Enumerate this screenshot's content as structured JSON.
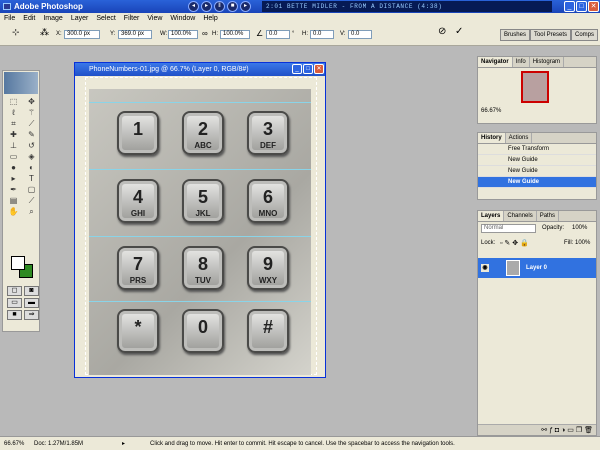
{
  "titlebar": {
    "title": "Adobe Photoshop",
    "track": "2:01   BETTE MIDLER - FROM A DISTANCE (4:38)"
  },
  "menu": [
    "File",
    "Edit",
    "Image",
    "Layer",
    "Select",
    "Filter",
    "View",
    "Window",
    "Help"
  ],
  "options": {
    "x_label": "X:",
    "x_value": "300.0 px",
    "y_label": "Y:",
    "y_value": "369.0 px",
    "w_label": "W:",
    "w_value": "100.0%",
    "h_label": "H:",
    "h_value": "100.0%",
    "angle": "0.0",
    "angle_unit": "°",
    "h_skew_label": "H:",
    "h_skew": "0.0",
    "v_skew_label": "V:",
    "v_skew": "0.0",
    "tabs": [
      "Brushes",
      "Tool Presets",
      "Comps"
    ]
  },
  "document": {
    "title": "PhoneNumbers-01.jpg @ 66.7% (Layer 0, RGB/8#)",
    "keys": [
      {
        "d": "1",
        "l": ""
      },
      {
        "d": "2",
        "l": "ABC"
      },
      {
        "d": "3",
        "l": "DEF"
      },
      {
        "d": "4",
        "l": "GHI"
      },
      {
        "d": "5",
        "l": "JKL"
      },
      {
        "d": "6",
        "l": "MNO"
      },
      {
        "d": "7",
        "l": "PRS"
      },
      {
        "d": "8",
        "l": "TUV"
      },
      {
        "d": "9",
        "l": "WXY"
      },
      {
        "d": "*",
        "l": ""
      },
      {
        "d": "0",
        "l": ""
      },
      {
        "d": "#",
        "l": ""
      }
    ]
  },
  "navigator": {
    "tabs": [
      "Navigator",
      "Info",
      "Histogram"
    ],
    "zoom": "66.67%"
  },
  "history": {
    "tabs": [
      "History",
      "Actions"
    ],
    "items": [
      "Free Transform",
      "New Guide",
      "New Guide",
      "New Guide"
    ]
  },
  "layers": {
    "tabs": [
      "Layers",
      "Channels",
      "Paths"
    ],
    "blend": "Normal",
    "opacity_label": "Opacity:",
    "opacity": "100%",
    "lock_label": "Lock:",
    "fill_label": "Fill:",
    "fill": "100%",
    "layer_name": "Layer 0"
  },
  "status": {
    "zoom": "66.67%",
    "doc": "Doc: 1.27M/1.85M",
    "hint": "Click and drag to move. Hit enter to commit. Hit escape to cancel. Use the spacebar to access the navigation tools."
  },
  "colors": {
    "foreground": "#ffffff",
    "background": "#2e8a22",
    "accent": "#3172e0"
  }
}
